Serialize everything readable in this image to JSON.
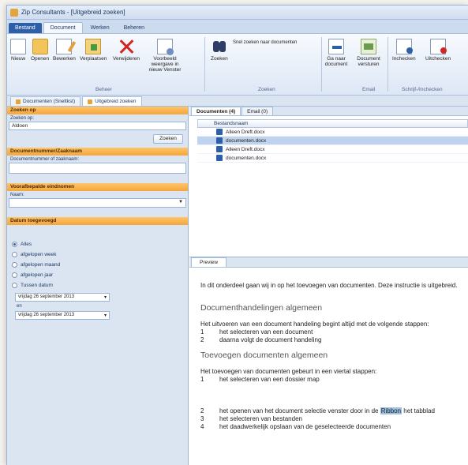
{
  "window": {
    "title": "Zip Consultants - [Uitgebreid zoeken]"
  },
  "menu": {
    "file": "Bestand",
    "tabs": [
      "Document",
      "Werken",
      "Beheren"
    ]
  },
  "ribbon": {
    "buttons": {
      "new": "Nieuw",
      "open": "Openen",
      "edit": "Bewerken",
      "move": "Verplaatsen",
      "delete": "Verwijderen",
      "preview": "Voorbeeld weergave in nieuw Venster",
      "search": "Zoeken",
      "goto": "Ga naar document",
      "send": "Document versturen",
      "checkin": "Inchecken",
      "checkout": "Uitchecken"
    },
    "search_hint": "Snel zoeken naar documenten",
    "groups": [
      "Beheer",
      "Zoeken",
      "Email",
      "Schrijf-/Inchecken"
    ]
  },
  "doc_tabs": [
    "Documenten (Sneltkst)",
    "Uitgebreid zoeken"
  ],
  "left": {
    "search_section": "Zoeken op",
    "search_label": "Zoeken op:",
    "search_value": "Aldoen",
    "search_button": "Zoeken",
    "docnum_section": "Documentnummer/Zaaknaam",
    "docnum_label": "Documentnummer of zaaknaam:",
    "type_section": "Voorafbepalde eindnomen",
    "type_label": "Naam:",
    "date_section": "Datum toegevoegd",
    "radios": [
      "Alles",
      "afgelopen week",
      "afgelopen maand",
      "afgelopen jaar",
      "Tussen datum"
    ],
    "selected_radio": 0,
    "date_from": "vrijdag   26 september 2013",
    "date_en": "en",
    "date_to": "vrijdag   26 september 2013"
  },
  "results": {
    "tabs": [
      "Documenten (4)",
      "Email (0)"
    ],
    "column": "Bestandsnaam",
    "rows": [
      "Alleen Dreft.docx",
      "documenten.docx",
      "Alleen Dreft.docx",
      "documenten.docx"
    ],
    "selected_row": 1
  },
  "preview": {
    "tab": "Preview",
    "intro": "In dit onderdeel gaan wij in op het toevoegen van documenten. Deze instructie is uitgebreid.",
    "h1": "Documenthandelingen algemeen",
    "p1": "Het uitvoeren van een document handeling begint altijd met de volgende stappen:",
    "steps1": [
      [
        "1",
        "het selecteren van een document"
      ],
      [
        "2",
        "daarna volgt de document handeling"
      ]
    ],
    "h2": "Toevoegen documenten algemeen",
    "p2": "Het toevoegen van documenten gebeurt in een viertal stappen:",
    "steps2": [
      [
        "1",
        "het selecteren van een dossier map"
      ]
    ],
    "steps3a_pre": "het openen van het document selectie venster door in de",
    "steps3a_hl": "Ribbon",
    "steps3a_post": "het tabblad",
    "steps3": [
      [
        "3",
        "het selecteren van bestanden"
      ],
      [
        "4",
        "het daadwerkelijk opslaan van de geselecteerde documenten"
      ]
    ]
  }
}
